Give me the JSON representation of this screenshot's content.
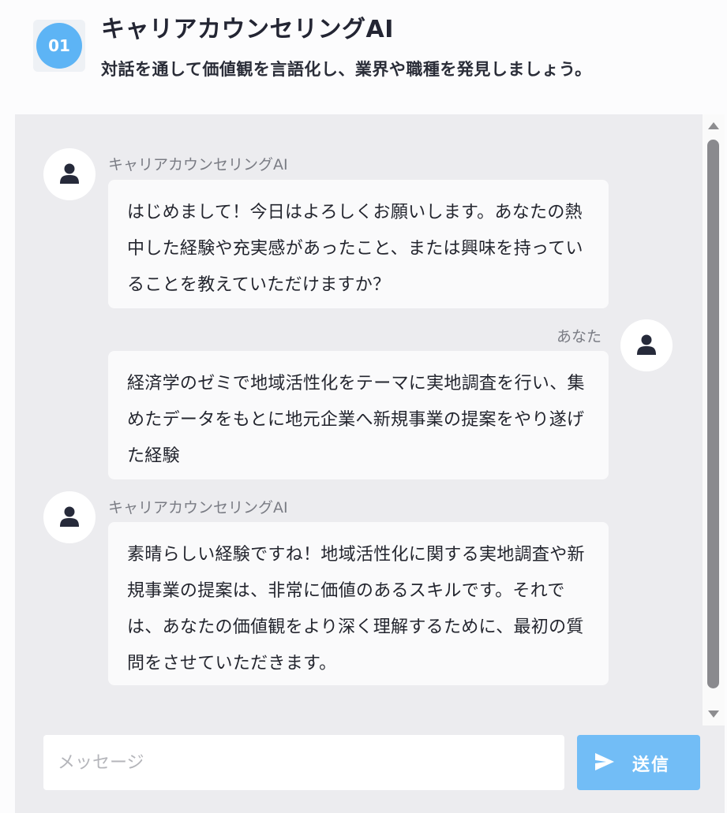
{
  "header": {
    "step_number": "01",
    "title": "キャリアカウンセリングAI",
    "subtitle": "対話を通して価値観を言語化し、業界や職種を発見しましょう。"
  },
  "messages": [
    {
      "role": "ai",
      "sender": "キャリアカウンセリングAI",
      "avatar_icon": "user-icon",
      "text": "はじめまして！今日はよろしくお願いします。あなたの熱中した経験や充実感があったこと、または興味を持っていることを教えていただけますか？"
    },
    {
      "role": "user",
      "sender": "あなた",
      "avatar_icon": "user-icon",
      "text": "経済学のゼミで地域活性化をテーマに実地調査を行い、集めたデータをもとに地元企業へ新規事業の提案をやり遂げた経験"
    },
    {
      "role": "ai",
      "sender": "キャリアカウンセリングAI",
      "avatar_icon": "user-icon",
      "text": "素晴らしい経験ですね！地域活性化に関する実地調査や新規事業の提案は、非常に価値のあるスキルです。それでは、あなたの価値観をより深く理解するために、最初の質問をさせていただきます。"
    }
  ],
  "input": {
    "value": "",
    "placeholder": "メッセージ"
  },
  "send": {
    "label": "送信",
    "icon": "send-icon"
  },
  "colors": {
    "accent": "#5db4f5",
    "send_button": "#72bdf6",
    "chat_background": "#ececef",
    "bubble_background": "#fafafb"
  }
}
